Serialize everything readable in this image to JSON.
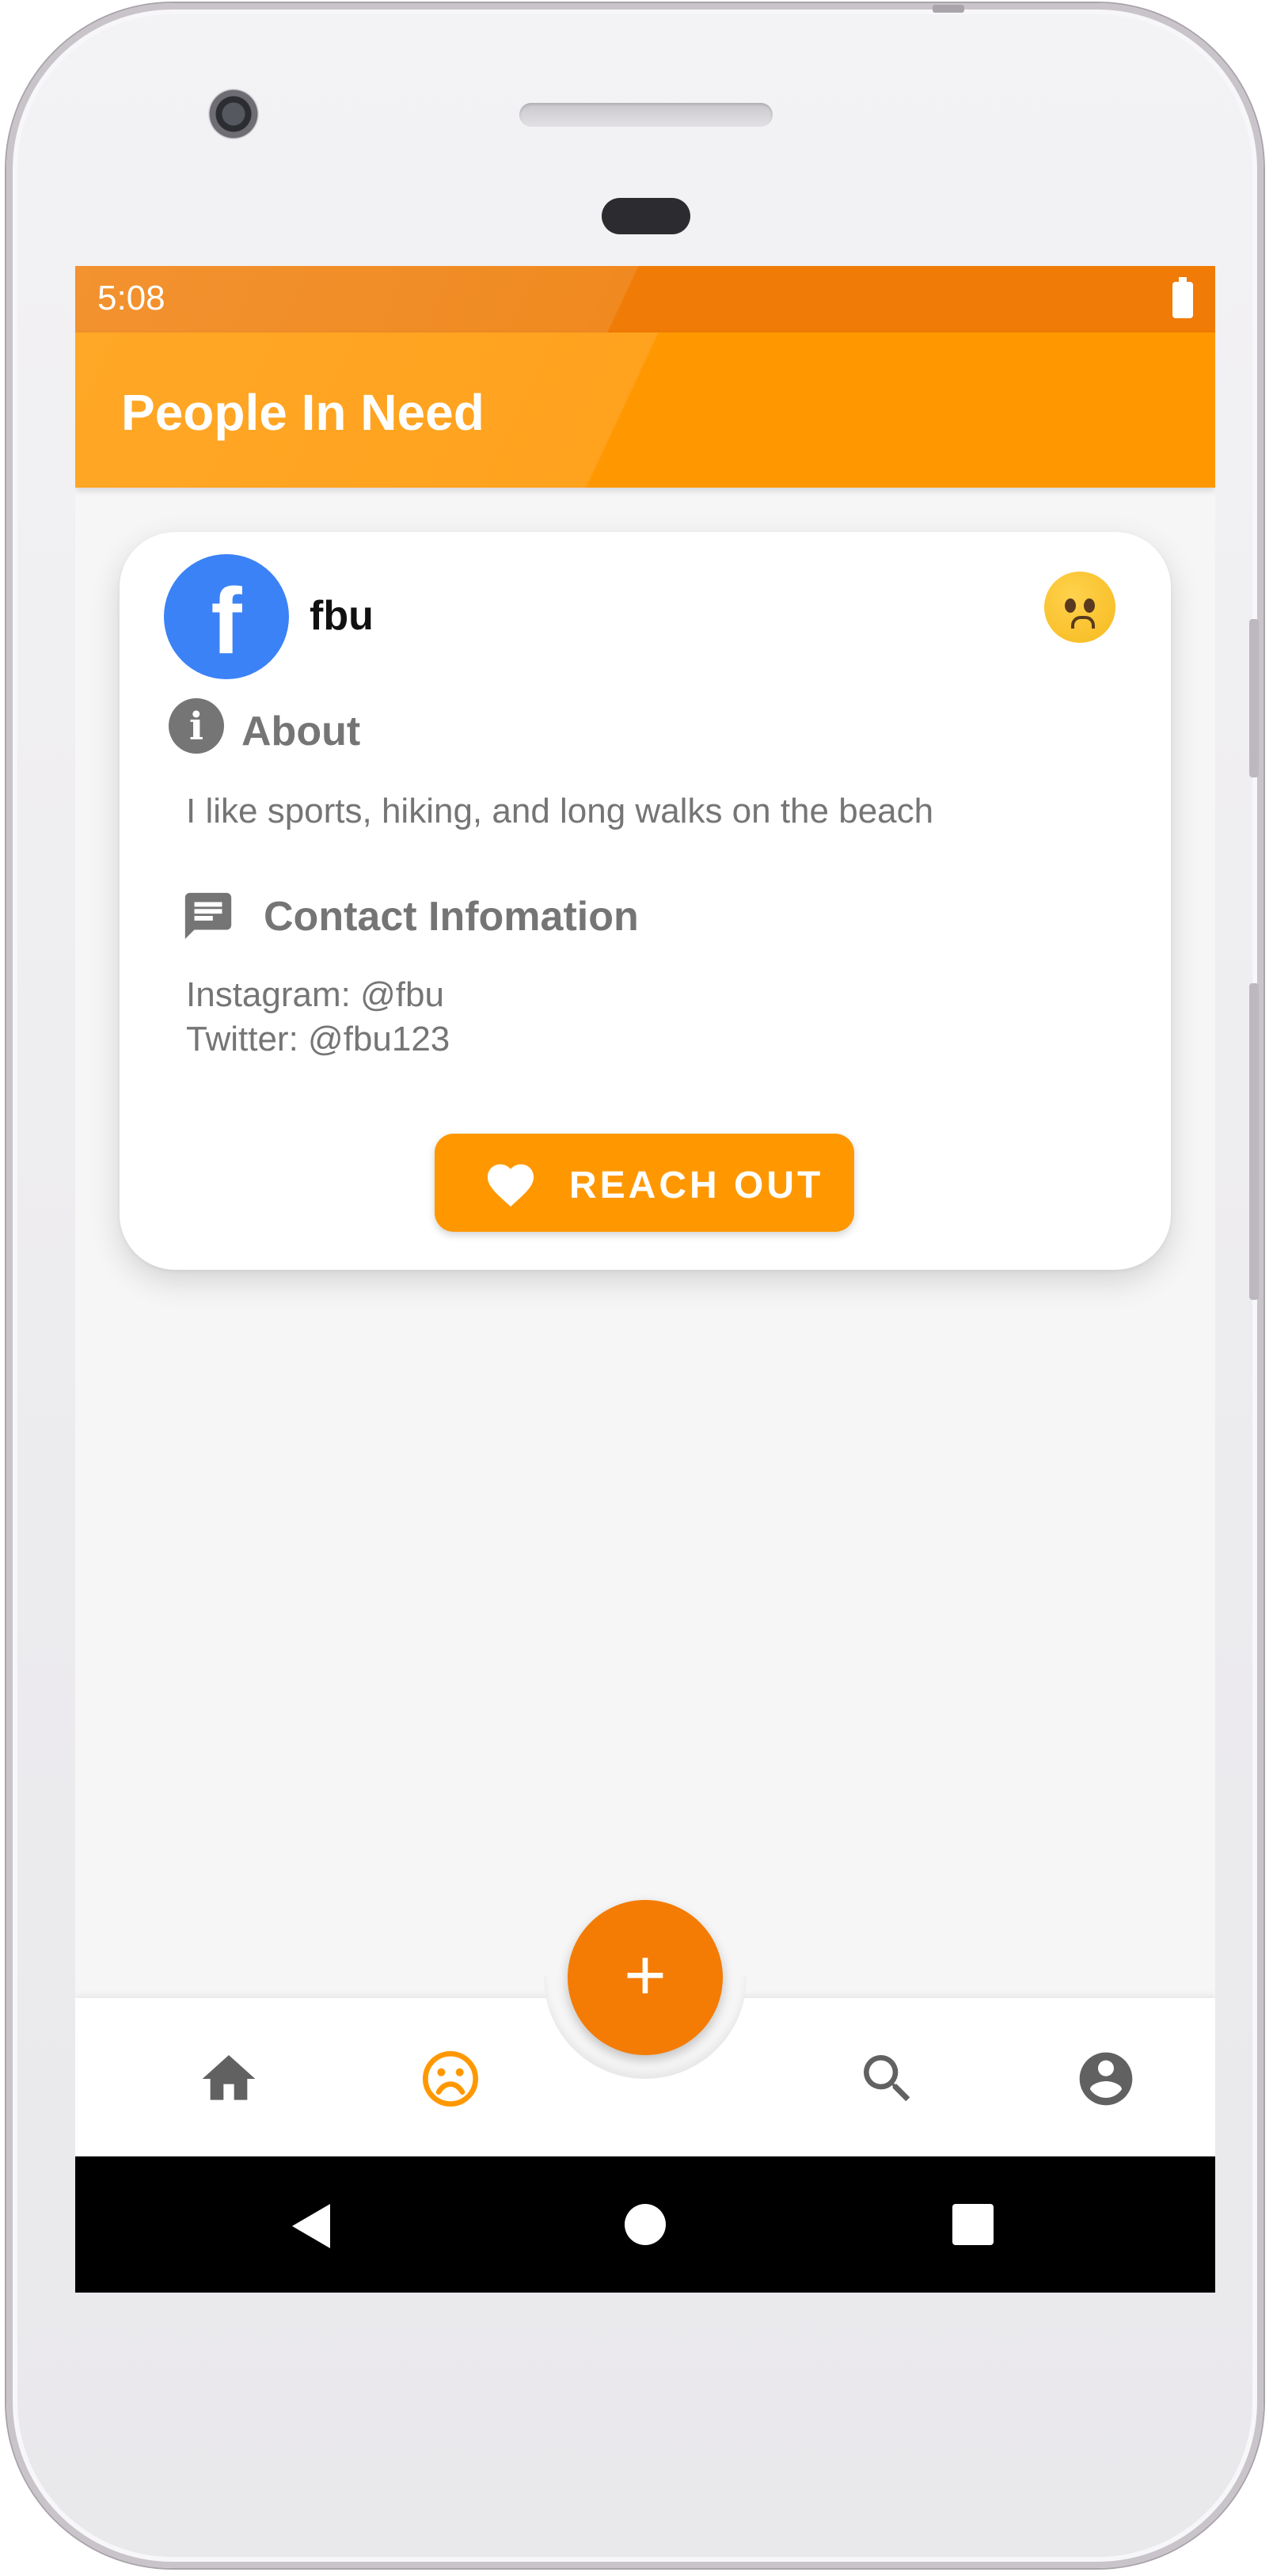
{
  "status_bar": {
    "time": "5:08"
  },
  "app_bar": {
    "title": "People In Need"
  },
  "card": {
    "avatar_letter": "f",
    "username": "fbu",
    "mood_icon": "sad-face-emoji-icon",
    "about": {
      "heading": "About",
      "text": "I like sports, hiking, and long walks on the beach"
    },
    "contact": {
      "heading": "Contact Infomation",
      "lines": [
        "Instagram: @fbu",
        "Twitter: @fbu123"
      ]
    },
    "reach_out_label": "REACH OUT"
  },
  "fab": {
    "label": "+"
  },
  "bottom_nav": {
    "items": [
      {
        "name": "home",
        "icon": "home-icon",
        "active": false
      },
      {
        "name": "people-in-need",
        "icon": "sad-face-icon",
        "active": true
      },
      {
        "name": "search",
        "icon": "search-icon",
        "active": false
      },
      {
        "name": "profile",
        "icon": "account-circle-icon",
        "active": false
      }
    ]
  },
  "colors": {
    "primary": "#ff9800",
    "primary_dark": "#f57c00",
    "icon_gray": "#616161",
    "text_gray": "#757575",
    "facebook_blue": "#3b82f6"
  }
}
